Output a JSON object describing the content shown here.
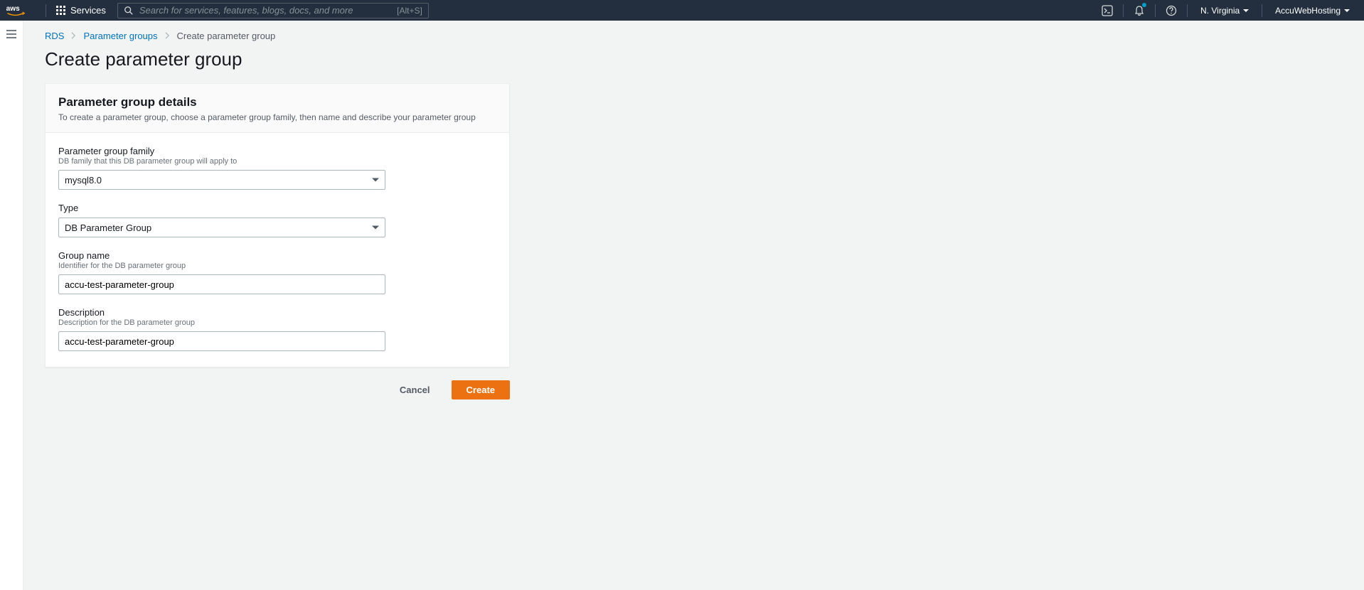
{
  "nav": {
    "services_label": "Services",
    "search_placeholder": "Search for services, features, blogs, docs, and more",
    "search_shortcut": "[Alt+S]",
    "region": "N. Virginia",
    "account": "AccuWebHosting"
  },
  "breadcrumbs": {
    "root": "RDS",
    "parent": "Parameter groups",
    "current": "Create parameter group"
  },
  "page": {
    "title": "Create parameter group"
  },
  "card": {
    "title": "Parameter group details",
    "subtitle": "To create a parameter group, choose a parameter group family, then name and describe your parameter group"
  },
  "form": {
    "family": {
      "label": "Parameter group family",
      "hint": "DB family that this DB parameter group will apply to",
      "value": "mysql8.0"
    },
    "type": {
      "label": "Type",
      "value": "DB Parameter Group"
    },
    "group_name": {
      "label": "Group name",
      "hint": "Identifier for the DB parameter group",
      "value": "accu-test-parameter-group"
    },
    "description": {
      "label": "Description",
      "hint": "Description for the DB parameter group",
      "value": "accu-test-parameter-group"
    }
  },
  "actions": {
    "cancel": "Cancel",
    "create": "Create"
  }
}
